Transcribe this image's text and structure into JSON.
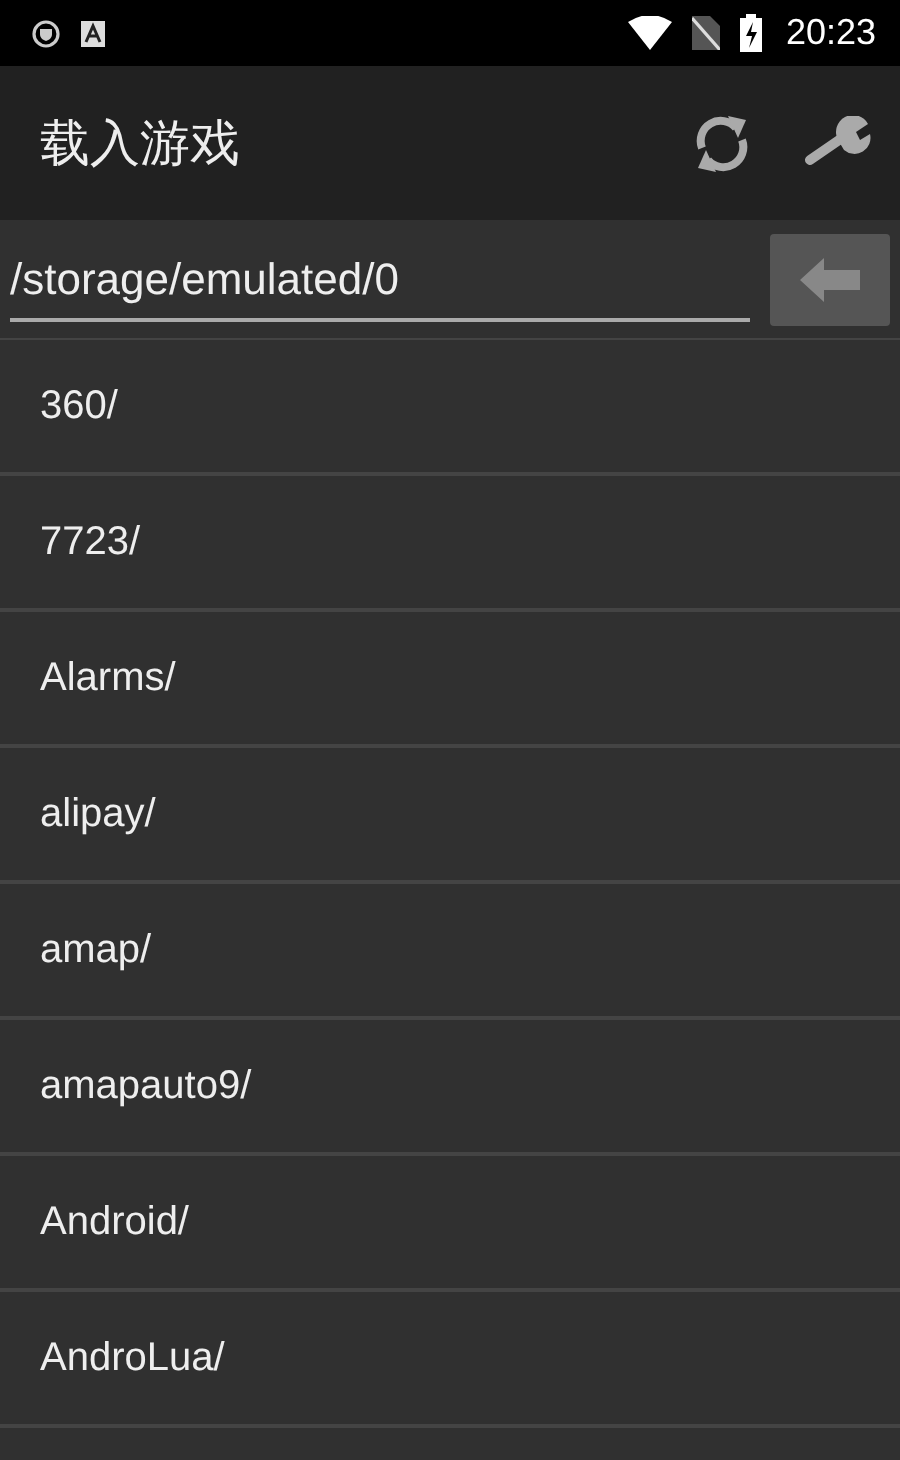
{
  "status_bar": {
    "time": "20:23"
  },
  "toolbar": {
    "title": "载入游戏"
  },
  "path_bar": {
    "value": "/storage/emulated/0"
  },
  "files": [
    {
      "name": "360/"
    },
    {
      "name": "7723/"
    },
    {
      "name": "Alarms/"
    },
    {
      "name": "alipay/"
    },
    {
      "name": "amap/"
    },
    {
      "name": "amapauto9/"
    },
    {
      "name": "Android/"
    },
    {
      "name": "AndroLua/"
    }
  ]
}
